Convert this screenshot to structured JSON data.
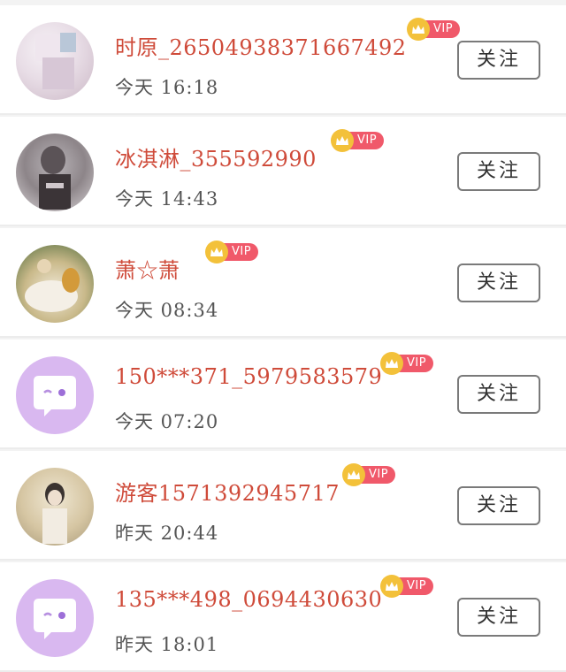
{
  "users": [
    {
      "name": "时原_26504938371667492",
      "time": "今天  16:18",
      "vip": "VIP",
      "follow": "关注",
      "avatar": "photo-avatar-light"
    },
    {
      "name": "冰淇淋_355592990",
      "time": "今天  14:43",
      "vip": "VIP",
      "follow": "关注",
      "avatar": "photo-avatar-gray"
    },
    {
      "name": "萧☆萧",
      "time": "今天  08:34",
      "vip": "VIP",
      "follow": "关注",
      "avatar": "photo-avatar-gold"
    },
    {
      "name": "150***371_5979583579",
      "time": "今天  07:20",
      "vip": "VIP",
      "follow": "关注",
      "avatar": "default-chat-avatar"
    },
    {
      "name": "游客1571392945717",
      "time": "昨天  20:44",
      "vip": "VIP",
      "follow": "关注",
      "avatar": "photo-avatar-beige"
    },
    {
      "name": "135***498_0694430630",
      "time": "昨天  18:01",
      "vip": "VIP",
      "follow": "关注",
      "avatar": "default-chat-avatar"
    }
  ],
  "colors": {
    "name": "#cf4b3a",
    "vip_tag": "#f0596a",
    "crown": "#f3c13a",
    "default_avatar": "#d9b8f0"
  }
}
